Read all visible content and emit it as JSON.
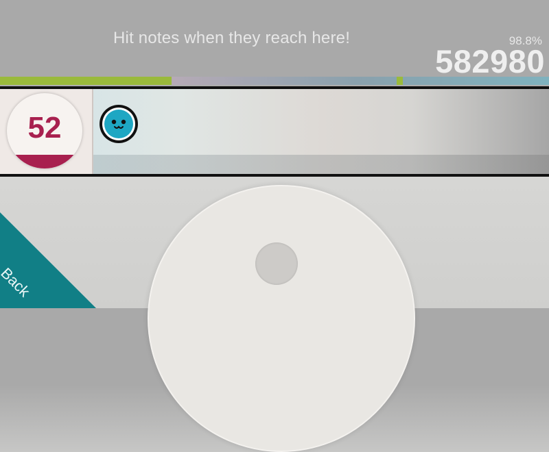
{
  "hud": {
    "hint": "Hit notes when they reach here!",
    "accuracy": "98.8%",
    "score": "582980"
  },
  "combo": {
    "count": "52",
    "gauge_fraction": 0.18
  },
  "back": {
    "label": "Back"
  },
  "colors": {
    "accent_teal": "#117f86",
    "combo_crimson": "#a8204f",
    "progress_green": "#9aba3c",
    "note_blue": "#1ea7c3"
  }
}
